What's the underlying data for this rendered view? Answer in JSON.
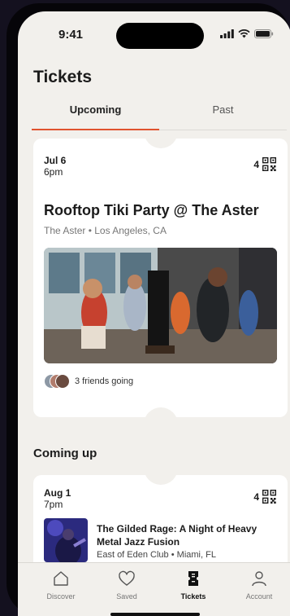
{
  "status_bar": {
    "time": "9:41"
  },
  "page": {
    "title": "Tickets"
  },
  "tabs": [
    {
      "label": "Upcoming",
      "active": true
    },
    {
      "label": "Past",
      "active": false
    }
  ],
  "featured_ticket": {
    "date": "Jul 6",
    "time": "6pm",
    "quantity": "4",
    "title": "Rooftop Tiki Party @ The Aster",
    "venue": "The Aster • Los Angeles, CA",
    "friends_text": "3 friends going"
  },
  "coming_up": {
    "section_title": "Coming up",
    "items": [
      {
        "date": "Aug 1",
        "time": "7pm",
        "quantity": "4",
        "title": "The Gilded Rage: A Night of Heavy Metal Jazz Fusion",
        "venue": "East of Eden Club",
        "city": "Miami, FL"
      }
    ]
  },
  "tab_bar": [
    {
      "label": "Discover",
      "icon": "home-icon",
      "active": false
    },
    {
      "label": "Saved",
      "icon": "heart-icon",
      "active": false
    },
    {
      "label": "Tickets",
      "icon": "ticket-icon",
      "active": true
    },
    {
      "label": "Account",
      "icon": "person-icon",
      "active": false
    }
  ],
  "colors": {
    "accent": "#e0532f",
    "background": "#f2f0ec",
    "card": "#ffffff"
  }
}
